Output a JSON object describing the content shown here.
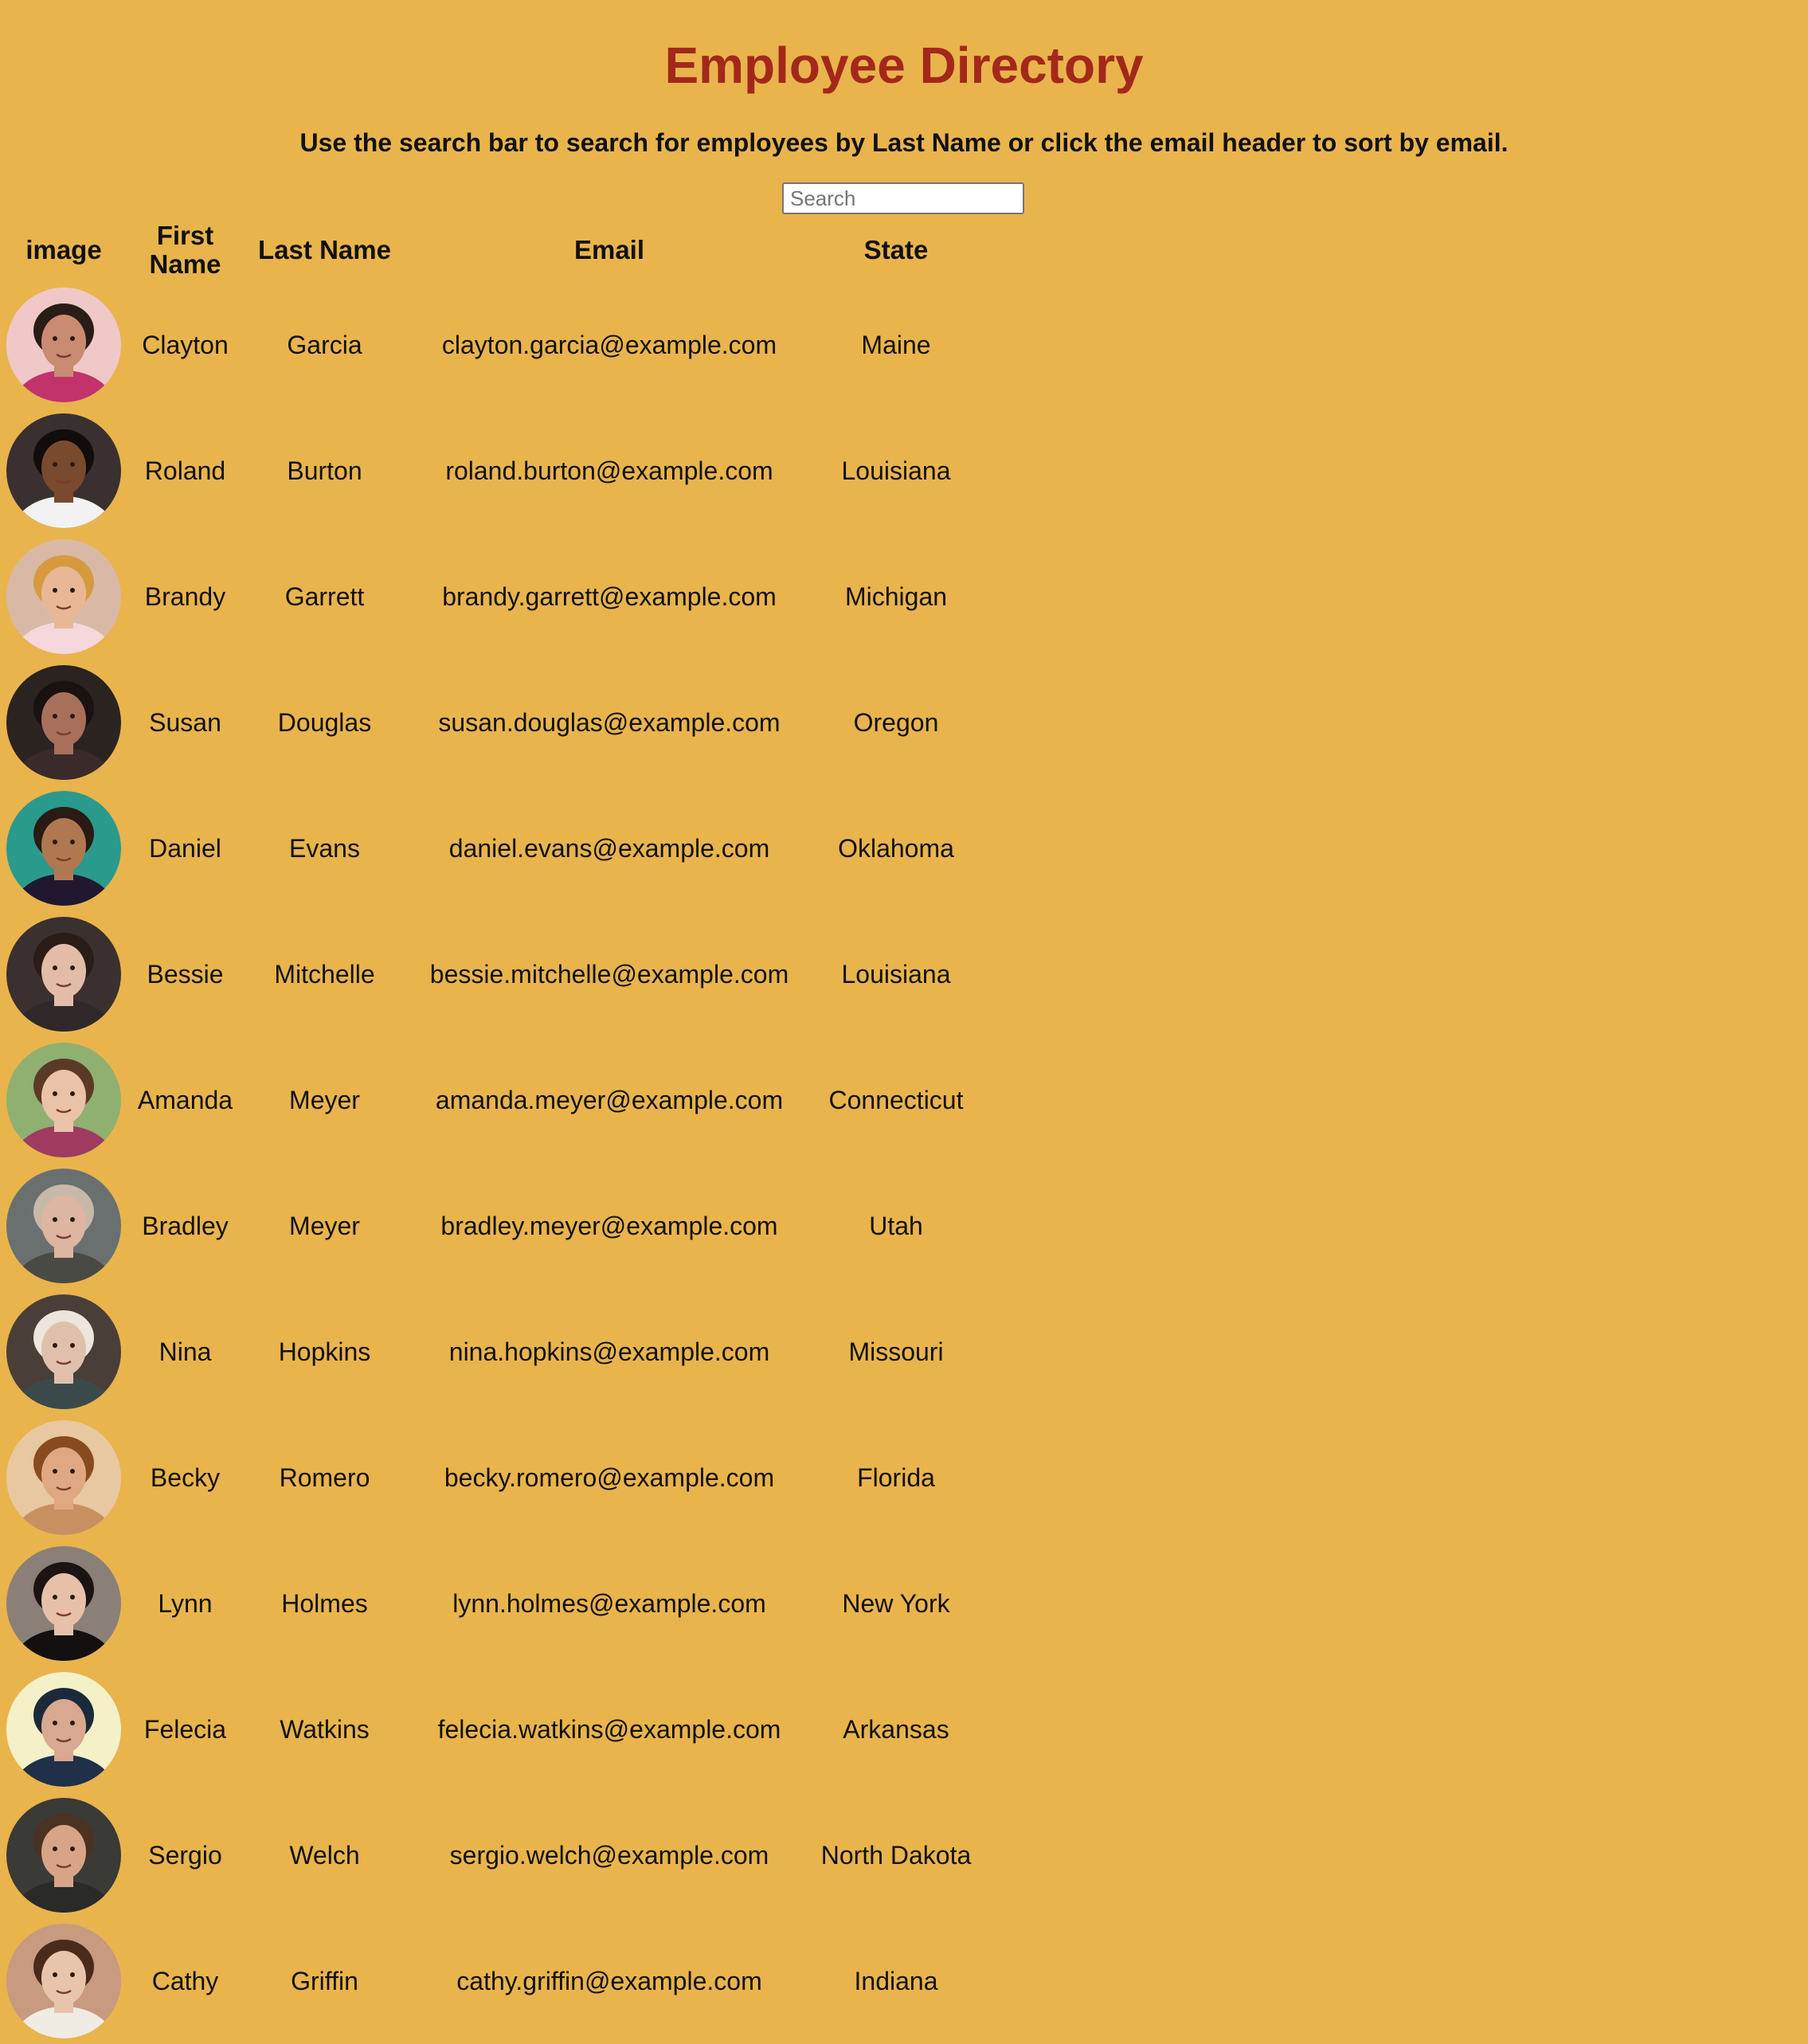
{
  "page": {
    "title": "Employee Directory",
    "subtitle": "Use the search bar to search for employees by Last Name or click the email header to sort by email."
  },
  "search": {
    "placeholder": "Search",
    "value": ""
  },
  "table": {
    "headers": {
      "image": "image",
      "first_name": "First Name",
      "last_name": "Last Name",
      "email": "Email",
      "state": "State"
    },
    "rows": [
      {
        "first": "Clayton",
        "last": "Garcia",
        "email": "clayton.garcia@example.com",
        "state": "Maine",
        "avatar": {
          "icon": "avatar-photo",
          "bg": "#f0c8c8",
          "skin": "#c98b72",
          "hair": "#2a1c16",
          "shirt": "#c2336b"
        }
      },
      {
        "first": "Roland",
        "last": "Burton",
        "email": "roland.burton@example.com",
        "state": "Louisiana",
        "avatar": {
          "icon": "avatar-photo",
          "bg": "#3a3030",
          "skin": "#7a4a2e",
          "hair": "#120c0a",
          "shirt": "#f2f2f2"
        }
      },
      {
        "first": "Brandy",
        "last": "Garrett",
        "email": "brandy.garrett@example.com",
        "state": "Michigan",
        "avatar": {
          "icon": "avatar-photo",
          "bg": "#d9b9a6",
          "skin": "#e8b896",
          "hair": "#d69a3e",
          "shirt": "#f5d7dc"
        }
      },
      {
        "first": "Susan",
        "last": "Douglas",
        "email": "susan.douglas@example.com",
        "state": "Oregon",
        "avatar": {
          "icon": "avatar-photo",
          "bg": "#2b2320",
          "skin": "#a8705a",
          "hair": "#1a1210",
          "shirt": "#3b2a2a"
        }
      },
      {
        "first": "Daniel",
        "last": "Evans",
        "email": "daniel.evans@example.com",
        "state": "Oklahoma",
        "avatar": {
          "icon": "avatar-photo",
          "bg": "#2a9a8c",
          "skin": "#b07850",
          "hair": "#2a1a14",
          "shirt": "#201830"
        }
      },
      {
        "first": "Bessie",
        "last": "Mitchelle",
        "email": "bessie.mitchelle@example.com",
        "state": "Louisiana",
        "avatar": {
          "icon": "avatar-photo",
          "bg": "#3a3030",
          "skin": "#e2bca6",
          "hair": "#2a1c16",
          "shirt": "#302828"
        }
      },
      {
        "first": "Amanda",
        "last": "Meyer",
        "email": "amanda.meyer@example.com",
        "state": "Connecticut",
        "avatar": {
          "icon": "avatar-photo",
          "bg": "#8fb070",
          "skin": "#eac2a8",
          "hair": "#5a3a26",
          "shirt": "#a03a60"
        }
      },
      {
        "first": "Bradley",
        "last": "Meyer",
        "email": "bradley.meyer@example.com",
        "state": "Utah",
        "avatar": {
          "icon": "avatar-photo",
          "bg": "#6a7070",
          "skin": "#dcb6a0",
          "hair": "#c8b8a8",
          "shirt": "#4a4a44"
        }
      },
      {
        "first": "Nina",
        "last": "Hopkins",
        "email": "nina.hopkins@example.com",
        "state": "Missouri",
        "avatar": {
          "icon": "avatar-photo",
          "bg": "#4a3e38",
          "skin": "#e0c0ac",
          "hair": "#ece6dc",
          "shirt": "#3a4a4a"
        }
      },
      {
        "first": "Becky",
        "last": "Romero",
        "email": "becky.romero@example.com",
        "state": "Florida",
        "avatar": {
          "icon": "avatar-photo",
          "bg": "#e8c8a0",
          "skin": "#e0a882",
          "hair": "#8a4a20",
          "shirt": "#c89060"
        }
      },
      {
        "first": "Lynn",
        "last": "Holmes",
        "email": "lynn.holmes@example.com",
        "state": "New York",
        "avatar": {
          "icon": "avatar-photo",
          "bg": "#8a8078",
          "skin": "#e6c0a8",
          "hair": "#1c1412",
          "shirt": "#141010"
        }
      },
      {
        "first": "Felecia",
        "last": "Watkins",
        "email": "felecia.watkins@example.com",
        "state": "Arkansas",
        "avatar": {
          "icon": "avatar-photo",
          "bg": "#f4f0c8",
          "skin": "#d8a890",
          "hair": "#1a2a3a",
          "shirt": "#203048"
        }
      },
      {
        "first": "Sergio",
        "last": "Welch",
        "email": "sergio.welch@example.com",
        "state": "North Dakota",
        "avatar": {
          "icon": "avatar-photo",
          "bg": "#3a3a36",
          "skin": "#d8a488",
          "hair": "#4a3220",
          "shirt": "#2a2a28"
        }
      },
      {
        "first": "Cathy",
        "last": "Griffin",
        "email": "cathy.griffin@example.com",
        "state": "Indiana",
        "avatar": {
          "icon": "avatar-photo",
          "bg": "#c89a80",
          "skin": "#e8c4ac",
          "hair": "#4a2a1a",
          "shirt": "#f0ece4"
        }
      }
    ]
  }
}
